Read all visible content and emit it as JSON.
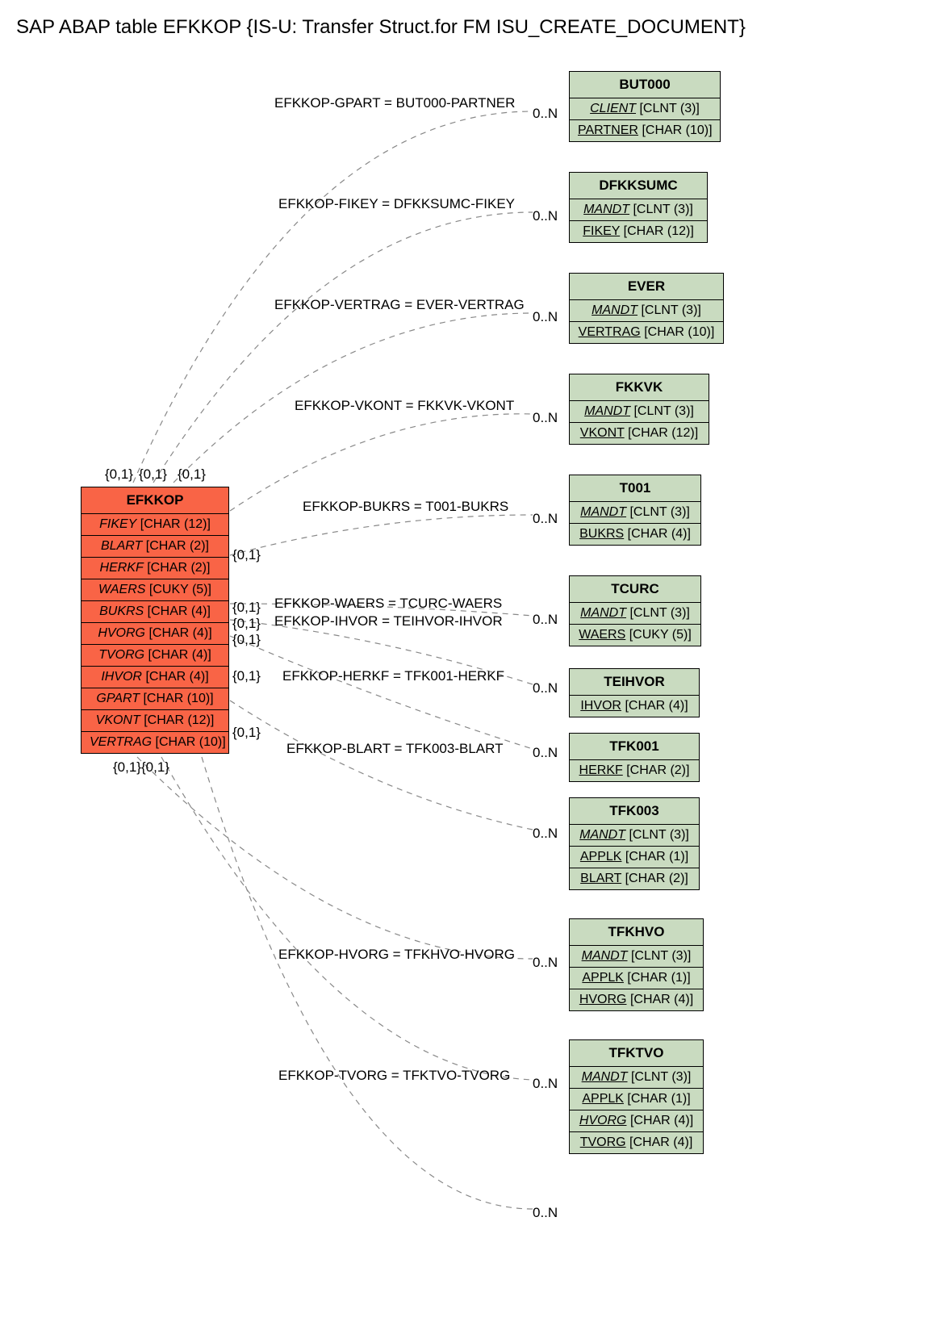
{
  "title": "SAP ABAP table EFKKOP {IS-U: Transfer Struct.for FM ISU_CREATE_DOCUMENT}",
  "main": {
    "name": "EFKKOP",
    "fields": [
      {
        "name": "FIKEY",
        "type": "[CHAR (12)]"
      },
      {
        "name": "BLART",
        "type": "[CHAR (2)]"
      },
      {
        "name": "HERKF",
        "type": "[CHAR (2)]"
      },
      {
        "name": "WAERS",
        "type": "[CUKY (5)]"
      },
      {
        "name": "BUKRS",
        "type": "[CHAR (4)]"
      },
      {
        "name": "HVORG",
        "type": "[CHAR (4)]"
      },
      {
        "name": "TVORG",
        "type": "[CHAR (4)]"
      },
      {
        "name": "IHVOR",
        "type": "[CHAR (4)]"
      },
      {
        "name": "GPART",
        "type": "[CHAR (10)]"
      },
      {
        "name": "VKONT",
        "type": "[CHAR (12)]"
      },
      {
        "name": "VERTRAG",
        "type": "[CHAR (10)]"
      }
    ]
  },
  "refs": [
    {
      "name": "BUT000",
      "fields": [
        {
          "n": "CLIENT",
          "t": "[CLNT (3)]",
          "ul": true,
          "it": true
        },
        {
          "n": "PARTNER",
          "t": "[CHAR (10)]",
          "ul": true
        }
      ]
    },
    {
      "name": "DFKKSUMC",
      "fields": [
        {
          "n": "MANDT",
          "t": "[CLNT (3)]",
          "ul": true,
          "it": true
        },
        {
          "n": "FIKEY",
          "t": "[CHAR (12)]",
          "ul": true
        }
      ]
    },
    {
      "name": "EVER",
      "fields": [
        {
          "n": "MANDT",
          "t": "[CLNT (3)]",
          "ul": true,
          "it": true
        },
        {
          "n": "VERTRAG",
          "t": "[CHAR (10)]",
          "ul": true
        }
      ]
    },
    {
      "name": "FKKVK",
      "fields": [
        {
          "n": "MANDT",
          "t": "[CLNT (3)]",
          "ul": true,
          "it": true
        },
        {
          "n": "VKONT",
          "t": "[CHAR (12)]",
          "ul": true
        }
      ]
    },
    {
      "name": "T001",
      "fields": [
        {
          "n": "MANDT",
          "t": "[CLNT (3)]",
          "ul": true,
          "it": true
        },
        {
          "n": "BUKRS",
          "t": "[CHAR (4)]",
          "ul": true
        }
      ]
    },
    {
      "name": "TCURC",
      "fields": [
        {
          "n": "MANDT",
          "t": "[CLNT (3)]",
          "ul": true,
          "it": true
        },
        {
          "n": "WAERS",
          "t": "[CUKY (5)]",
          "ul": true
        }
      ]
    },
    {
      "name": "TEIHVOR",
      "fields": [
        {
          "n": "IHVOR",
          "t": "[CHAR (4)]",
          "ul": true
        }
      ]
    },
    {
      "name": "TFK001",
      "fields": [
        {
          "n": "HERKF",
          "t": "[CHAR (2)]",
          "ul": true
        }
      ]
    },
    {
      "name": "TFK003",
      "fields": [
        {
          "n": "MANDT",
          "t": "[CLNT (3)]",
          "ul": true,
          "it": true
        },
        {
          "n": "APPLK",
          "t": "[CHAR (1)]",
          "ul": true
        },
        {
          "n": "BLART",
          "t": "[CHAR (2)]",
          "ul": true
        }
      ]
    },
    {
      "name": "TFKHVO",
      "fields": [
        {
          "n": "MANDT",
          "t": "[CLNT (3)]",
          "ul": true,
          "it": true
        },
        {
          "n": "APPLK",
          "t": "[CHAR (1)]",
          "ul": true
        },
        {
          "n": "HVORG",
          "t": "[CHAR (4)]",
          "ul": true
        }
      ]
    },
    {
      "name": "TFKTVO",
      "fields": [
        {
          "n": "MANDT",
          "t": "[CLNT (3)]",
          "ul": true,
          "it": true
        },
        {
          "n": "APPLK",
          "t": "[CHAR (1)]",
          "ul": true
        },
        {
          "n": "HVORG",
          "t": "[CHAR (4)]",
          "ul": true,
          "it": true
        },
        {
          "n": "TVORG",
          "t": "[CHAR (4)]",
          "ul": true
        }
      ]
    }
  ],
  "edges": [
    {
      "label": "EFKKOP-GPART = BUT000-PARTNER",
      "card_r": "0..N"
    },
    {
      "label": "EFKKOP-FIKEY = DFKKSUMC-FIKEY",
      "card_r": "0..N"
    },
    {
      "label": "EFKKOP-VERTRAG = EVER-VERTRAG",
      "card_r": "0..N"
    },
    {
      "label": "EFKKOP-VKONT = FKKVK-VKONT",
      "card_r": "0..N"
    },
    {
      "label": "EFKKOP-BUKRS = T001-BUKRS",
      "card_r": "0..N"
    },
    {
      "label": "EFKKOP-WAERS = TCURC-WAERS",
      "card_r": "0..N"
    },
    {
      "label": "EFKKOP-IHVOR = TEIHVOR-IHVOR"
    },
    {
      "label": "EFKKOP-HERKF = TFK001-HERKF",
      "card_r": "0..N"
    },
    {
      "label": "EFKKOP-BLART = TFK003-BLART",
      "card_r": "0..N"
    },
    {
      "label": "EFKKOP-HVORG = TFKHVO-HVORG",
      "card_r": "0..N"
    },
    {
      "label": "EFKKOP-TVORG = TFKTVO-TVORG",
      "card_r": "0..N"
    }
  ],
  "card01": "{0,1}",
  "card01_double": "{0,1}{0,1}"
}
